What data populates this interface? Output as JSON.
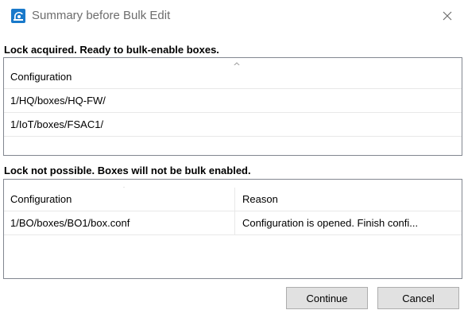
{
  "window": {
    "title": "Summary before Bulk Edit",
    "icon": "bulk-edit-app-icon",
    "close_icon": "close-icon"
  },
  "acquired": {
    "heading": "Lock acquired. Ready to bulk-enable boxes.",
    "columns": [
      "Configuration"
    ],
    "rows": [
      [
        "1/HQ/boxes/HQ-FW/"
      ],
      [
        "1/IoT/boxes/FSAC1/"
      ]
    ]
  },
  "not_possible": {
    "heading": "Lock not possible. Boxes will not be bulk enabled.",
    "columns": [
      "Configuration",
      "Reason"
    ],
    "rows": [
      [
        "1/BO/boxes/BO1/box.conf",
        "Configuration is opened. Finish confi..."
      ]
    ]
  },
  "buttons": {
    "continue_label": "Continue",
    "cancel_label": "Cancel"
  },
  "colors": {
    "border": "#828790",
    "button_bg": "#e1e1e1",
    "title_text": "#6d6d6d",
    "icon_blue": "#1979ca"
  }
}
